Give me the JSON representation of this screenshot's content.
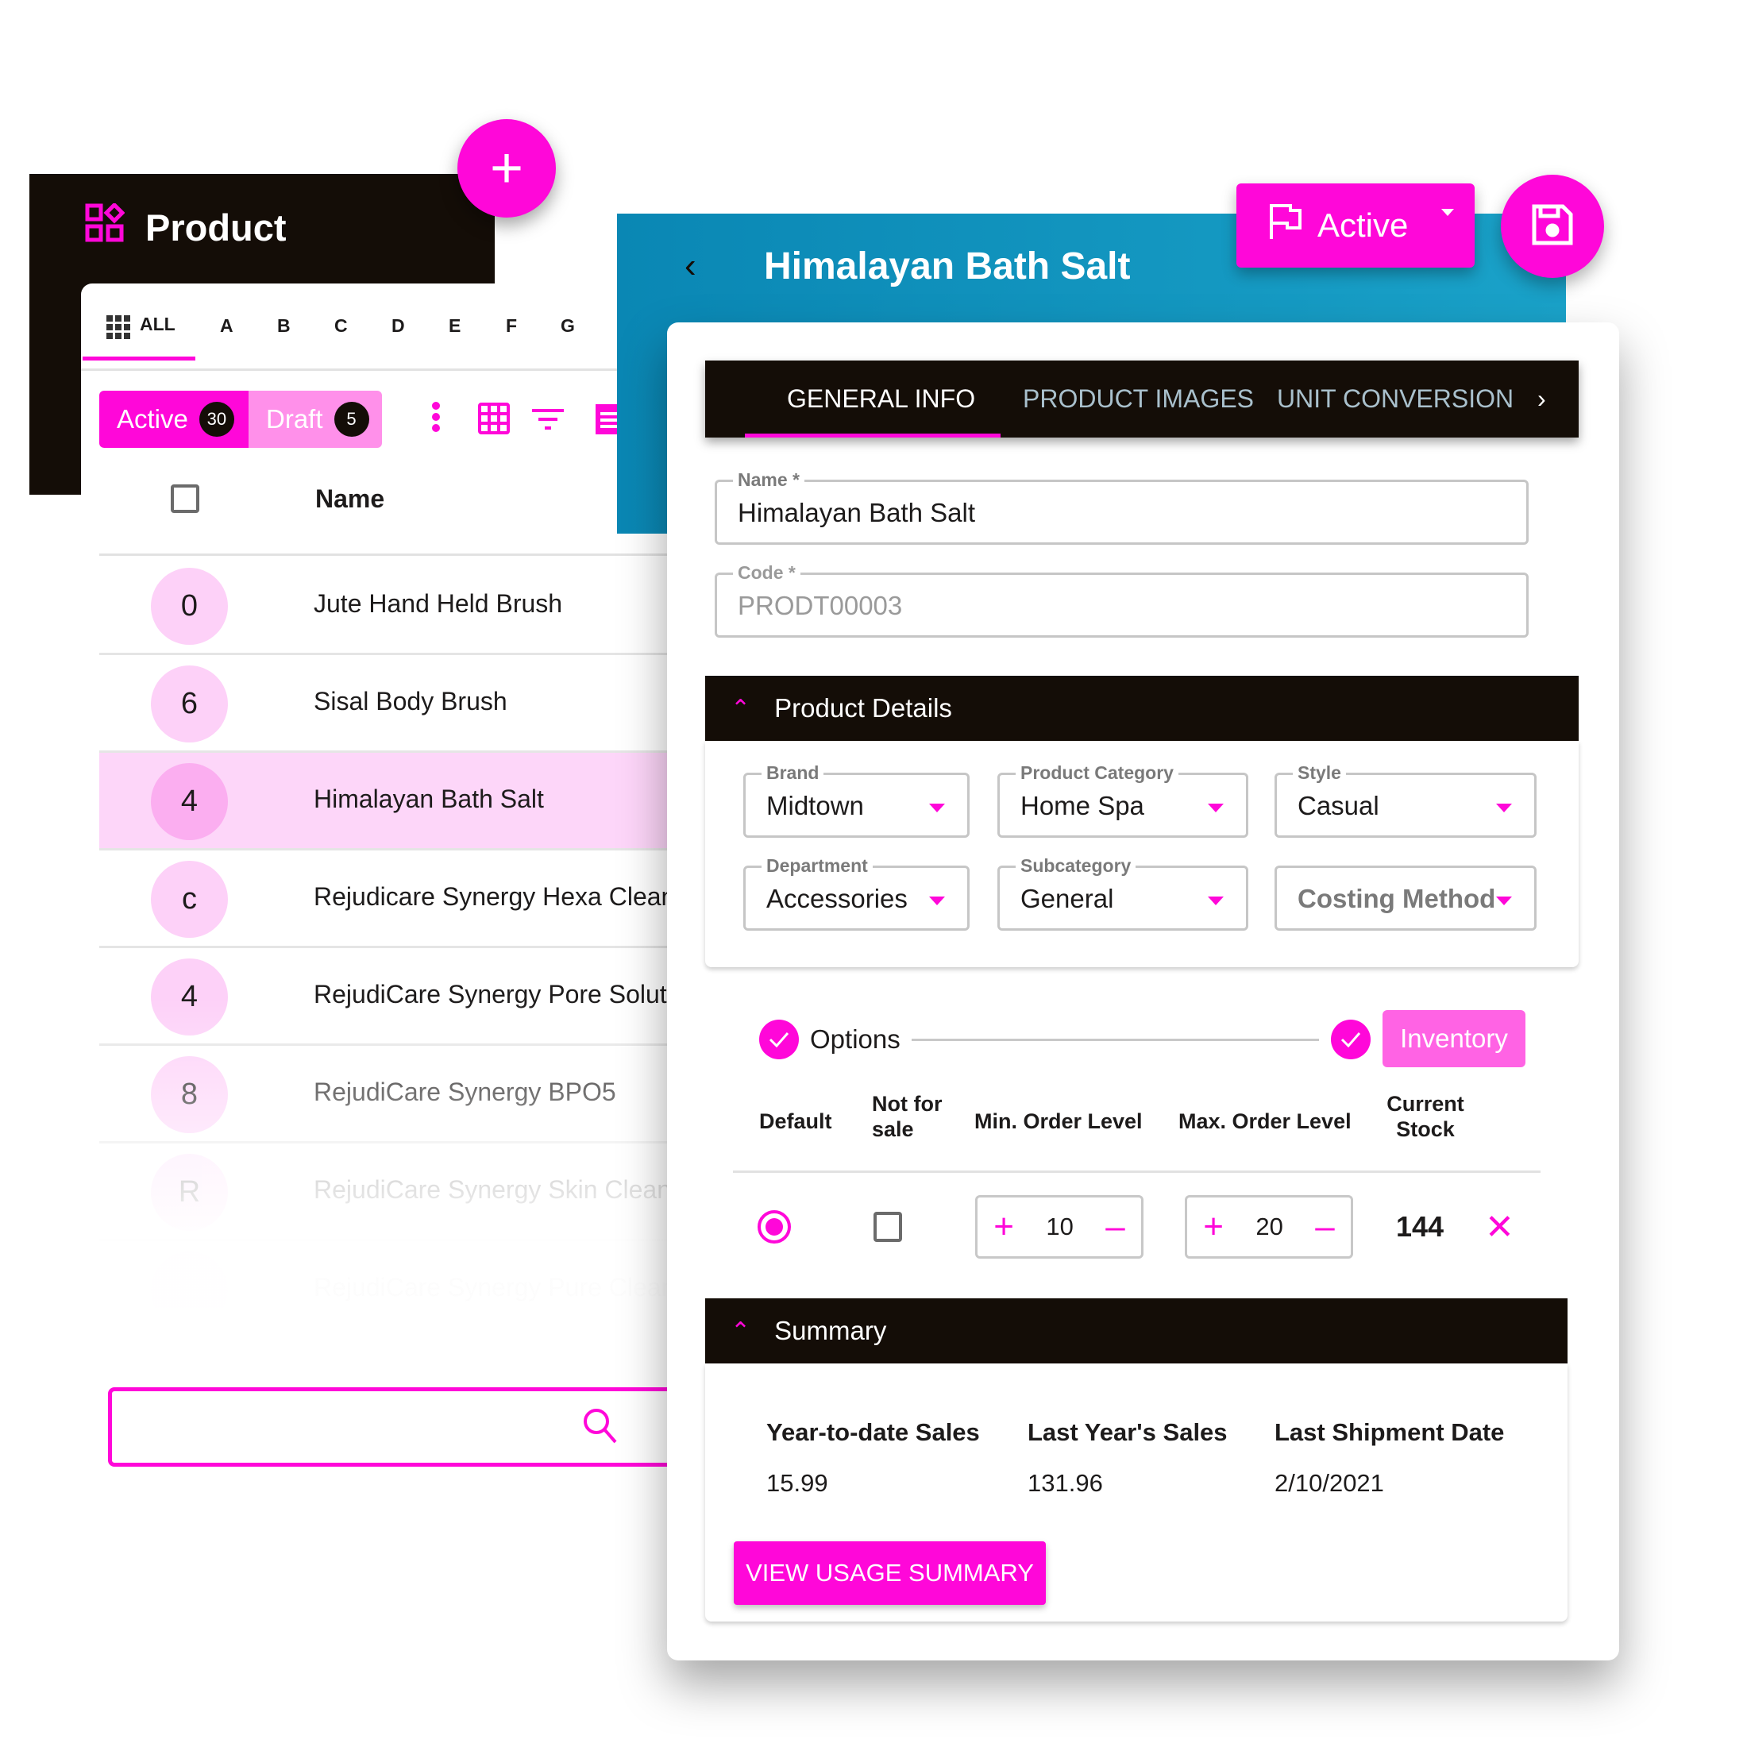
{
  "list_panel": {
    "title": "Product",
    "add_button_icon": "plus-icon",
    "alpha_filter": [
      "ALL",
      "A",
      "B",
      "C",
      "D",
      "E",
      "F",
      "G"
    ],
    "status_tabs": [
      {
        "label": "Active",
        "count": "30"
      },
      {
        "label": "Draft",
        "count": "5"
      }
    ],
    "column_header": "Name",
    "rows": [
      {
        "avatar": "0",
        "name": "Jute Hand Held Brush"
      },
      {
        "avatar": "6",
        "name": "Sisal Body Brush"
      },
      {
        "avatar": "4",
        "name": "Himalayan Bath Salt",
        "selected": true
      },
      {
        "avatar": "c",
        "name": "Rejudicare Synergy Hexa Clean"
      },
      {
        "avatar": "4",
        "name": "RejudiCare Synergy Pore Soluti"
      },
      {
        "avatar": "8",
        "name": "RejudiCare Synergy BPO5"
      },
      {
        "avatar": "R",
        "name": "RejudiCare Synergy Skin Cleans"
      },
      {
        "avatar": "",
        "name": "RejudiCare Synergy Pure Cleans"
      }
    ],
    "search": {
      "value": "",
      "placeholder": ""
    }
  },
  "detail": {
    "title": "Himalayan Bath Salt",
    "status": "Active",
    "tabs": [
      "GENERAL INFO",
      "PRODUCT IMAGES",
      "UNIT CONVERSION"
    ],
    "active_tab": "GENERAL INFO",
    "name": {
      "label": "Name *",
      "value": "Himalayan Bath Salt"
    },
    "code": {
      "label": "Code *",
      "value": "PRODT00003"
    },
    "product_details": {
      "title": "Product Details",
      "fields": [
        {
          "label": "Brand",
          "value": "Midtown"
        },
        {
          "label": "Product Category",
          "value": "Home Spa"
        },
        {
          "label": "Style",
          "value": "Casual"
        },
        {
          "label": "Department",
          "value": "Accessories"
        },
        {
          "label": "Subcategory",
          "value": "General"
        },
        {
          "label": "",
          "value": "Costing Method"
        }
      ]
    },
    "steps": [
      "Options",
      "Inventory"
    ],
    "inventory": {
      "headers": [
        "Default",
        "Not for sale",
        "Min. Order Level",
        "Max. Order Level",
        "Current Stock"
      ],
      "row": {
        "default": true,
        "not_for_sale": false,
        "min_order": "10",
        "max_order": "20",
        "current_stock": "144"
      }
    },
    "summary": {
      "title": "Summary",
      "headers": [
        "Year-to-date Sales",
        "Last Year's Sales",
        "Last Shipment Date"
      ],
      "values": [
        "15.99",
        "131.96",
        "2/10/2021"
      ],
      "button": "VIEW USAGE SUMMARY"
    }
  },
  "colors": {
    "accent": "#ff07d9",
    "accent_light": "#ff90ea",
    "dark": "#140d07",
    "header_blue": "#0f94c0"
  }
}
